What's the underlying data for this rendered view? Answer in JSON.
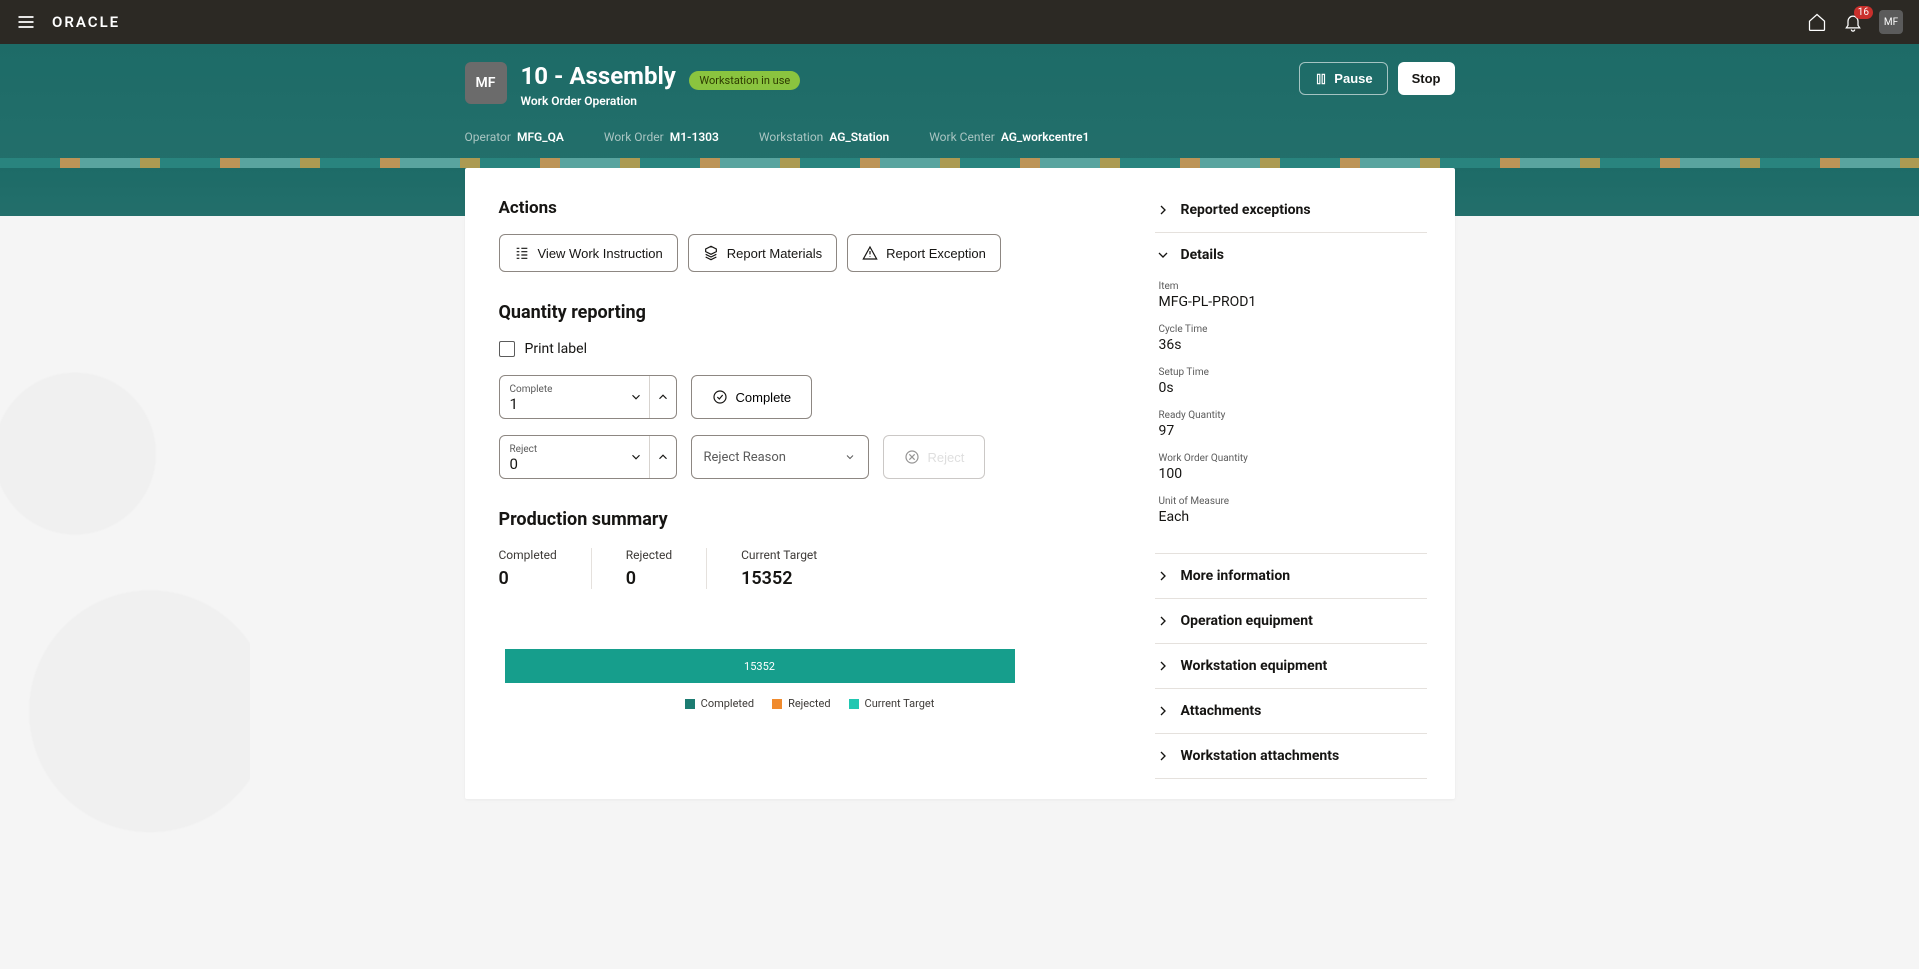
{
  "global": {
    "brand": "ORACLE",
    "notif_count": "16",
    "avatar": "MF"
  },
  "header": {
    "avatar": "MF",
    "title": "10 - Assembly",
    "status": "Workstation in use",
    "subtitle": "Work Order Operation",
    "pause": "Pause",
    "stop": "Stop",
    "meta": {
      "operator_lbl": "Operator",
      "operator_val": "MFG_QA",
      "workorder_lbl": "Work Order",
      "workorder_val": "M1-1303",
      "workstation_lbl": "Workstation",
      "workstation_val": "AG_Station",
      "workcenter_lbl": "Work Center",
      "workcenter_val": "AG_workcentre1"
    }
  },
  "actions": {
    "heading": "Actions",
    "view_instruction": "View Work Instruction",
    "report_materials": "Report Materials",
    "report_exception": "Report Exception"
  },
  "qty": {
    "heading": "Quantity reporting",
    "print_label": "Print label",
    "complete_lbl": "Complete",
    "complete_val": "1",
    "complete_btn": "Complete",
    "reject_lbl": "Reject",
    "reject_val": "0",
    "reject_reason": "Reject Reason",
    "reject_btn": "Reject"
  },
  "summary": {
    "heading": "Production summary",
    "completed_lbl": "Completed",
    "completed_val": "0",
    "rejected_lbl": "Rejected",
    "rejected_val": "0",
    "target_lbl": "Current Target",
    "target_val": "15352",
    "legend_completed": "Completed",
    "legend_rejected": "Rejected",
    "legend_target": "Current Target"
  },
  "chart_data": {
    "type": "bar",
    "orientation": "horizontal",
    "series": [
      {
        "name": "Completed",
        "value": 0,
        "color": "#1c7c72"
      },
      {
        "name": "Rejected",
        "value": 0,
        "color": "#f08b2e"
      },
      {
        "name": "Current Target",
        "value": 15352,
        "color": "#21c7b1"
      }
    ],
    "bar_label": "15352"
  },
  "side": {
    "exceptions": "Reported exceptions",
    "details": "Details",
    "item_lbl": "Item",
    "item_val": "MFG-PL-PROD1",
    "cycle_lbl": "Cycle Time",
    "cycle_val": "36s",
    "setup_lbl": "Setup Time",
    "setup_val": "0s",
    "ready_lbl": "Ready Quantity",
    "ready_val": "97",
    "woqty_lbl": "Work Order Quantity",
    "woqty_val": "100",
    "uom_lbl": "Unit of Measure",
    "uom_val": "Each",
    "more_info": "More information",
    "op_eq": "Operation equipment",
    "ws_eq": "Workstation equipment",
    "attach": "Attachments",
    "ws_attach": "Workstation attachments"
  }
}
